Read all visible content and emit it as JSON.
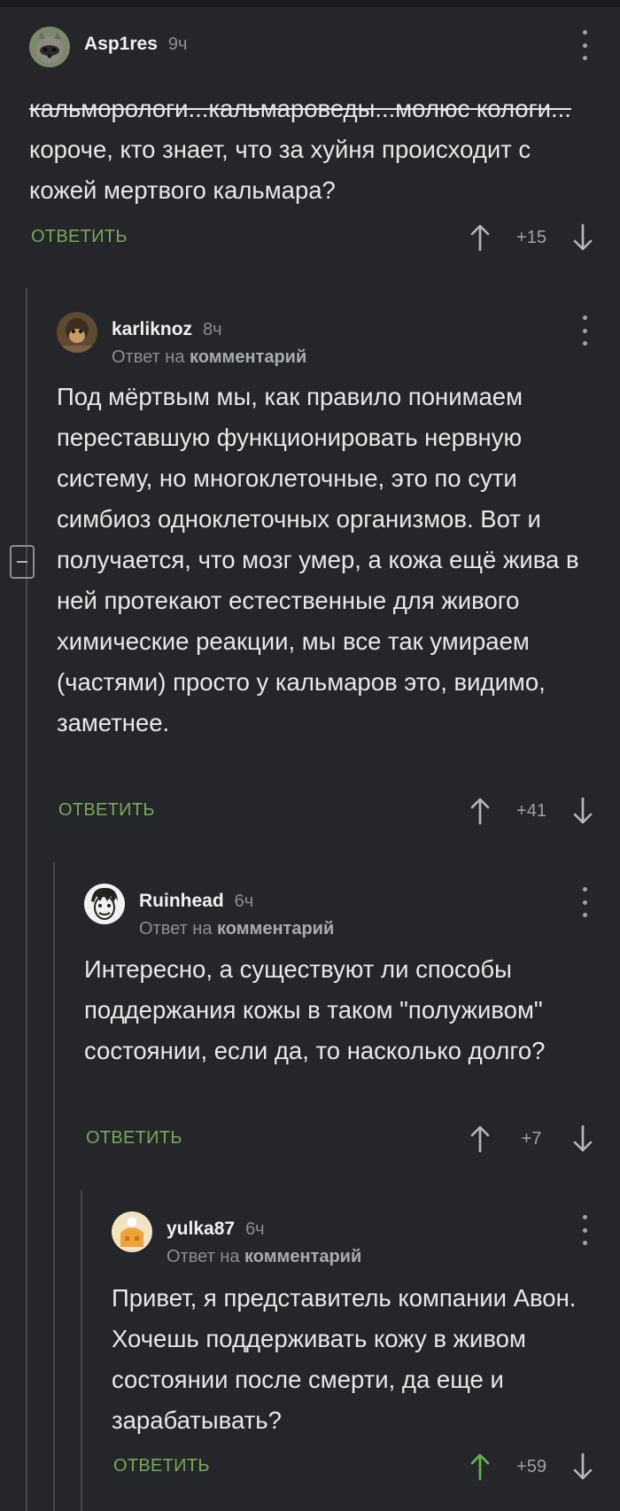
{
  "comments": [
    {
      "user": "Asp1res",
      "time": "9ч",
      "text_strike": "кальморологи...кальмароведы...молюс кологи...",
      "text": " короче, кто знает, что за хуйня происходит с кожей мертвого кальмара?",
      "reply_label": "ОТВЕТИТЬ",
      "score": "+15"
    },
    {
      "user": "karliknoz",
      "time": "8ч",
      "reply_prefix": "Ответ на",
      "reply_target": "комментарий",
      "text": "Под мёртвым мы, как правило понимаем переставшую функционировать нервную систему, но многоклеточные, это по сути симбиоз одноклеточных организмов. Вот и получается, что мозг умер, а кожа ещё жива в ней протекают естественные для живого химические реакции, мы все так умираем (частями) просто у кальмаров это, видимо,  заметнее.",
      "reply_label": "ОТВЕТИТЬ",
      "score": "+41"
    },
    {
      "user": "Ruinhead",
      "time": "6ч",
      "reply_prefix": "Ответ на",
      "reply_target": "комментарий",
      "text": "Интересно, а существуют ли способы поддержания кожы в таком \"полуживом\" состоянии, если да, то насколько долго?",
      "reply_label": "ОТВЕТИТЬ",
      "score": "+7"
    },
    {
      "user": "yulka87",
      "time": "6ч",
      "reply_prefix": "Ответ на",
      "reply_target": "комментарий",
      "text": "Привет, я представитель компании Авон. Хочешь поддерживать кожу в живом состоянии после смерти, да еще и зарабатывать?",
      "reply_label": "ОТВЕТИТЬ",
      "score": "+59"
    }
  ],
  "colors": {
    "background": "#24262a",
    "accent_green": "#79a85a",
    "upvoted_green": "#5fb04a",
    "muted_text": "#8b8e93"
  },
  "icons": {
    "upvote": "arrow-up-icon",
    "downvote": "arrow-down-icon",
    "menu": "more-vertical-icon",
    "collapse": "minus-square-icon"
  }
}
